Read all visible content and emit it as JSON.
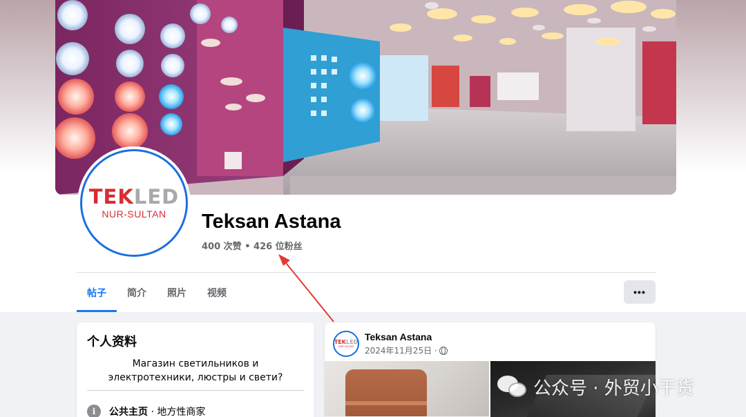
{
  "profile": {
    "name": "Teksan Astana",
    "stats": "400 次赞 • 426 位粉丝",
    "logo_main_red": "TEK",
    "logo_main_grey": "LED",
    "logo_sub": "NUR-SULTAN"
  },
  "tabs": [
    {
      "label": "帖子",
      "active": true
    },
    {
      "label": "简介",
      "active": false
    },
    {
      "label": "照片",
      "active": false
    },
    {
      "label": "视频",
      "active": false
    }
  ],
  "more_button_label": "•••",
  "intro": {
    "title": "个人资料",
    "bio": "Магазин светильников и электротехники, люстры и свети?",
    "category_label": "公共主页",
    "category_value": " · 地方性商家"
  },
  "post": {
    "author": "Teksan Astana",
    "date": "2024年11月25日 ·",
    "privacy_icon": "globe-icon"
  },
  "watermark": {
    "text": "公众号 · 外贸小干货",
    "icon": "wechat-icon"
  },
  "colors": {
    "accent": "#1877f2",
    "brand_red": "#d62d33",
    "annotation_arrow": "#e53935"
  }
}
